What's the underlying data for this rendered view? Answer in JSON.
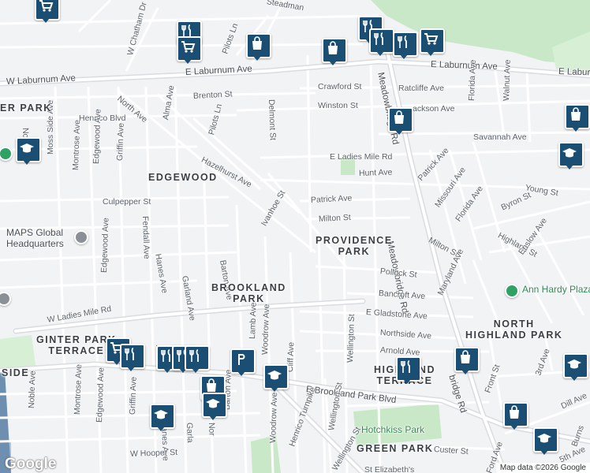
{
  "attribution": "Map data ©2026 Google",
  "logo": "Google",
  "colors": {
    "background": "#f2f3f5",
    "road": "#ffffff",
    "major_road": "#d9dce0",
    "park": "#c9e8c8",
    "marker": "#1a4e73",
    "poi_green": "#2e8b57"
  },
  "streets": {
    "w_laburnum": "W Laburnum Ave",
    "e_laburnum": "E Laburnum Ave",
    "e_laburnum_right": "E Laburn",
    "moss_side": "Moss Side Ave",
    "north_ave": "North Ave",
    "alma": "Alma Ave",
    "brenton": "Brenton St",
    "pilots_ln_top": "Pilots Ln",
    "pilots_ln": "Pilots Ln",
    "w_chatham": "W Chatham Dr",
    "steadman": "Steadman",
    "delmont": "Delmont St",
    "crawford": "Crawford St",
    "ratcliffe": "Ratcliffe Ave",
    "winston": "Winston St",
    "jackson": "ackson Ave",
    "henrico_blvd": "Henrico Blvd",
    "montrose_top": "Montrose Ave",
    "griffin_top": "Griffin Ave",
    "edgewood_top": "Edgewood Ave",
    "noble_top": "Nob",
    "hazelhurst": "Hazelhurst Ave",
    "savannah": "Savannah Ave",
    "florida_top": "Florida Ave",
    "walnut": "Walnut Ave",
    "meadowbridge_top": "Meadowbridge Rd",
    "e_ladies_mile": "E Ladies Mile Rd",
    "hunt": "Hunt Ave",
    "patrick_right": "Patrick Ave",
    "young": "Young St",
    "culpepper": "Culpepper St",
    "fendall": "Fendall Ave",
    "patrick": "Patrick Ave",
    "ivanhoe": "Ivanhoe St",
    "missouri": "Missouri Ave",
    "byron": "Byron St",
    "milton": "Milton St",
    "florida": "Florida Ave",
    "meadowbridge_mid": "Meadowbridge Rd",
    "highland": "Highland St",
    "milton_right": "Milton St",
    "enslow": "Enslow Ave",
    "hanes_top": "Hanes Ave",
    "garland_top": "Garland Ave",
    "barton_top": "Barton Ave",
    "edgewood_mid": "Edgewood Ave",
    "pollock": "Pollock St",
    "maryland": "Maryland Ave",
    "w_ladies_mile": "W Ladies Mile Rd",
    "bancroft": "Bancroft Ave",
    "e_gladstone": "E Gladstone Ave",
    "lamb": "Lamb Ave",
    "woodrow_top": "Woodrow Ave",
    "northside": "Northside Ave",
    "arnold": "Arnold Ave",
    "wellington_top": "Wellington St",
    "meadowbridge_bottom": "bridge Rd",
    "cliff": "Cliff Ave",
    "side_ave": "SIDE",
    "w_partial": "W",
    "noble_bottom": "Noble Ave",
    "montrose_bottom": "Montrose Ave",
    "edgewood_bottom": "Edgewood Ave",
    "griffin_bottom": "Griffin Ave",
    "hanes_bottom": "Hanes Ave",
    "garland_bottom": "Garla",
    "nor_partial": "Nor",
    "barton_bottom": "Barton Ave",
    "e_brookland_park": "E Brookland Park Blvd",
    "henrico_turnpike": "Henrico Turnpike",
    "woodrow_bottom": "Woodrow Ave",
    "wellington_bottom": "Wellington St",
    "wellington_bottom2": "Wellington St",
    "w_hooper": "W Hooper St",
    "custer": "Custer St",
    "front": "Front St",
    "third": "3rd Ave",
    "dill": "Dill Ave",
    "burns": "Burns",
    "fifth": "5th Ave",
    "ford": "Ford Ave",
    "st_elizabeth": "St Elizabeth's"
  },
  "neighborhoods": {
    "ginter_park_top": "ER PARK",
    "edgewood": "EDGEWOOD",
    "providence_park_1": "PROVIDENCE",
    "providence_park_2": "PARK",
    "brookland_park_1": "BROOKLAND",
    "brookland_park_2": "PARK",
    "ginter_park_terrace_1": "GINTER PARK",
    "ginter_park_terrace_2": "TERRACE",
    "north_highland_park_1": "NORTH",
    "north_highland_park_2": "HIGHLAND PARK",
    "highland_terrace_1": "HIGHLAND",
    "highland_terrace_2": "TERRACE",
    "green_park": "GREEN PARK"
  },
  "pois": {
    "maps_global_1": "MAPS Global",
    "maps_global_2": "Headquarters",
    "ann_hardy": "Ann Hardy Plaza",
    "hotchkiss": "Hotchkiss Park"
  },
  "markers": [
    {
      "type": "cart-icon"
    },
    {
      "type": "restaurant-icon"
    },
    {
      "type": "cart-icon"
    },
    {
      "type": "bag-icon"
    },
    {
      "type": "restaurant-icon"
    },
    {
      "type": "restaurant-icon"
    },
    {
      "type": "restaurant-icon"
    },
    {
      "type": "cart-icon"
    },
    {
      "type": "bag-icon"
    },
    {
      "type": "bag-icon"
    },
    {
      "type": "school-icon"
    },
    {
      "type": "bag-icon"
    },
    {
      "type": "school-icon"
    },
    {
      "type": "cart-icon"
    },
    {
      "type": "restaurant-icon"
    },
    {
      "type": "restaurant-icon"
    },
    {
      "type": "restaurant-icon"
    },
    {
      "type": "restaurant-icon"
    },
    {
      "type": "bag-icon"
    },
    {
      "type": "parking-icon"
    },
    {
      "type": "school-icon"
    },
    {
      "type": "school-icon"
    },
    {
      "type": "school-icon"
    },
    {
      "type": "restaurant-icon"
    },
    {
      "type": "bag-icon"
    },
    {
      "type": "school-icon"
    },
    {
      "type": "bag-icon"
    },
    {
      "type": "school-icon"
    }
  ]
}
